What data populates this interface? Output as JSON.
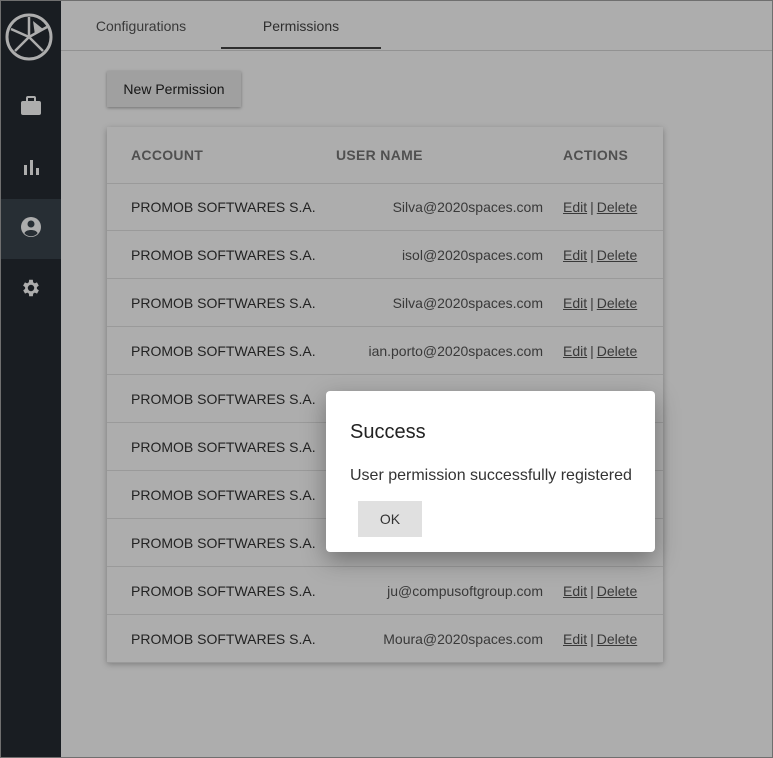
{
  "sidebar": {
    "logo_icon": "pizza-logo-icon",
    "items": [
      {
        "name": "briefcase-icon",
        "active": false
      },
      {
        "name": "bar-chart-icon",
        "active": false
      },
      {
        "name": "account-circle-icon",
        "active": true
      },
      {
        "name": "gear-icon",
        "active": false
      }
    ]
  },
  "tabs": [
    {
      "label": "Configurations",
      "active": false
    },
    {
      "label": "Permissions",
      "active": true
    }
  ],
  "new_permission_label": "New Permission",
  "table": {
    "headers": {
      "account": "ACCOUNT",
      "user_name": "USER NAME",
      "actions": "ACTIONS"
    },
    "rows": [
      {
        "account": "PROMOB SOFTWARES S.A.",
        "user": "Silva@2020spaces.com",
        "edit": "Edit",
        "sep": "|",
        "delete": "Delete"
      },
      {
        "account": "PROMOB SOFTWARES S.A.",
        "user": "isol@2020spaces.com",
        "edit": "Edit",
        "sep": "|",
        "delete": "Delete"
      },
      {
        "account": "PROMOB SOFTWARES S.A.",
        "user": "Silva@2020spaces.com",
        "edit": "Edit",
        "sep": "|",
        "delete": "Delete"
      },
      {
        "account": "PROMOB SOFTWARES S.A.",
        "user": "ian.porto@2020spaces.com",
        "edit": "Edit",
        "sep": "|",
        "delete": "Delete"
      },
      {
        "account": "PROMOB SOFTWARES S.A.",
        "user": "",
        "edit": "",
        "sep": "",
        "delete": ""
      },
      {
        "account": "PROMOB SOFTWARES S.A.",
        "user": "",
        "edit": "",
        "sep": "",
        "delete": ""
      },
      {
        "account": "PROMOB SOFTWARES S.A.",
        "user": "",
        "edit": "",
        "sep": "",
        "delete": ""
      },
      {
        "account": "PROMOB SOFTWARES S.A.",
        "user": "",
        "edit": "",
        "sep": "",
        "delete": ""
      },
      {
        "account": "PROMOB SOFTWARES S.A.",
        "user": "ju@compusoftgroup.com",
        "edit": "Edit",
        "sep": "|",
        "delete": "Delete"
      },
      {
        "account": "PROMOB SOFTWARES S.A.",
        "user": "Moura@2020spaces.com",
        "edit": "Edit",
        "sep": "|",
        "delete": "Delete"
      }
    ]
  },
  "dialog": {
    "title": "Success",
    "message": "User permission successfully registered",
    "ok_label": "OK"
  },
  "colors": {
    "sidebar_bg": "#252c33",
    "sidebar_active": "#3a444d",
    "overlay": "rgba(0,0,0,0.32)"
  }
}
